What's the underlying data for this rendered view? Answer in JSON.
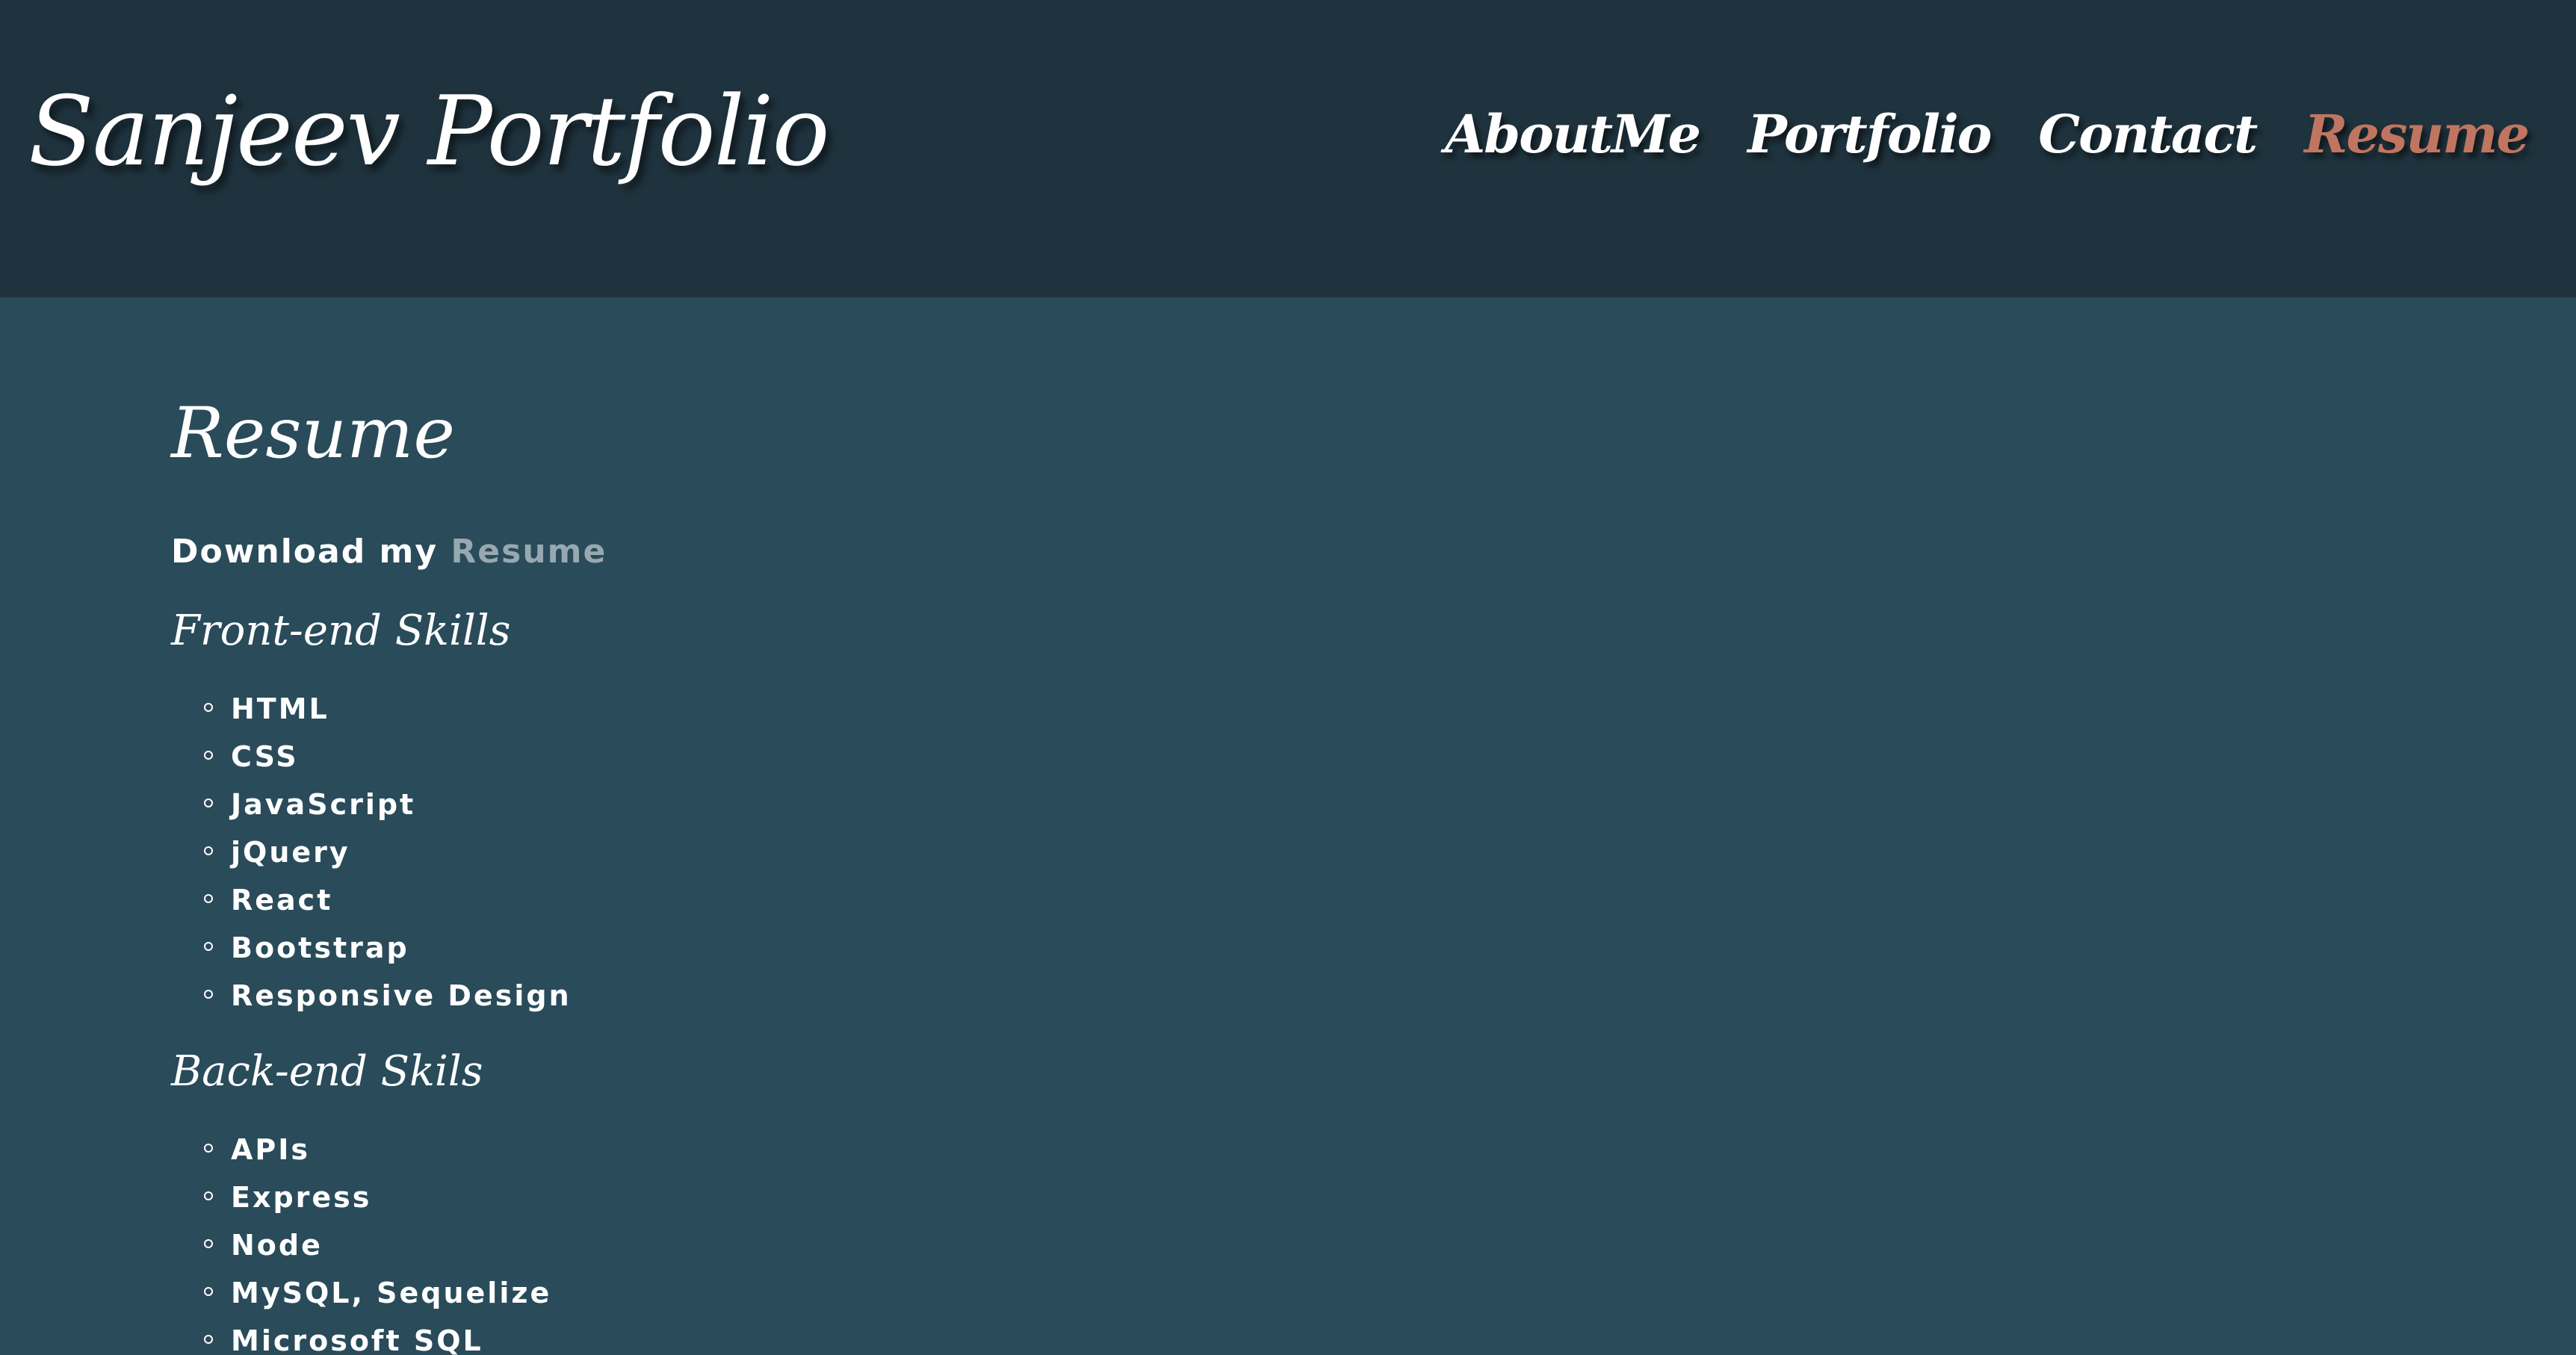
{
  "header": {
    "brand": "Sanjeev Portfolio",
    "nav": [
      {
        "label": "AboutMe",
        "active": false
      },
      {
        "label": "Portfolio",
        "active": false
      },
      {
        "label": "Contact",
        "active": false
      },
      {
        "label": "Resume",
        "active": true
      }
    ]
  },
  "main": {
    "title": "Resume",
    "download_prefix": "Download my",
    "download_link": "Resume",
    "frontend": {
      "title": "Front-end Skills",
      "items": [
        "HTML",
        "CSS",
        "JavaScript",
        "jQuery",
        "React",
        "Bootstrap",
        "Responsive Design"
      ]
    },
    "backend": {
      "title": "Back-end Skils",
      "items": [
        "APIs",
        "Express",
        "Node",
        "MySQL, Sequelize",
        "Microsoft SQL"
      ]
    }
  },
  "colors": {
    "header_bg": "#1f333e",
    "page_bg": "#294b5a",
    "accent": "#c07560",
    "link_muted": "#97a8b0"
  }
}
